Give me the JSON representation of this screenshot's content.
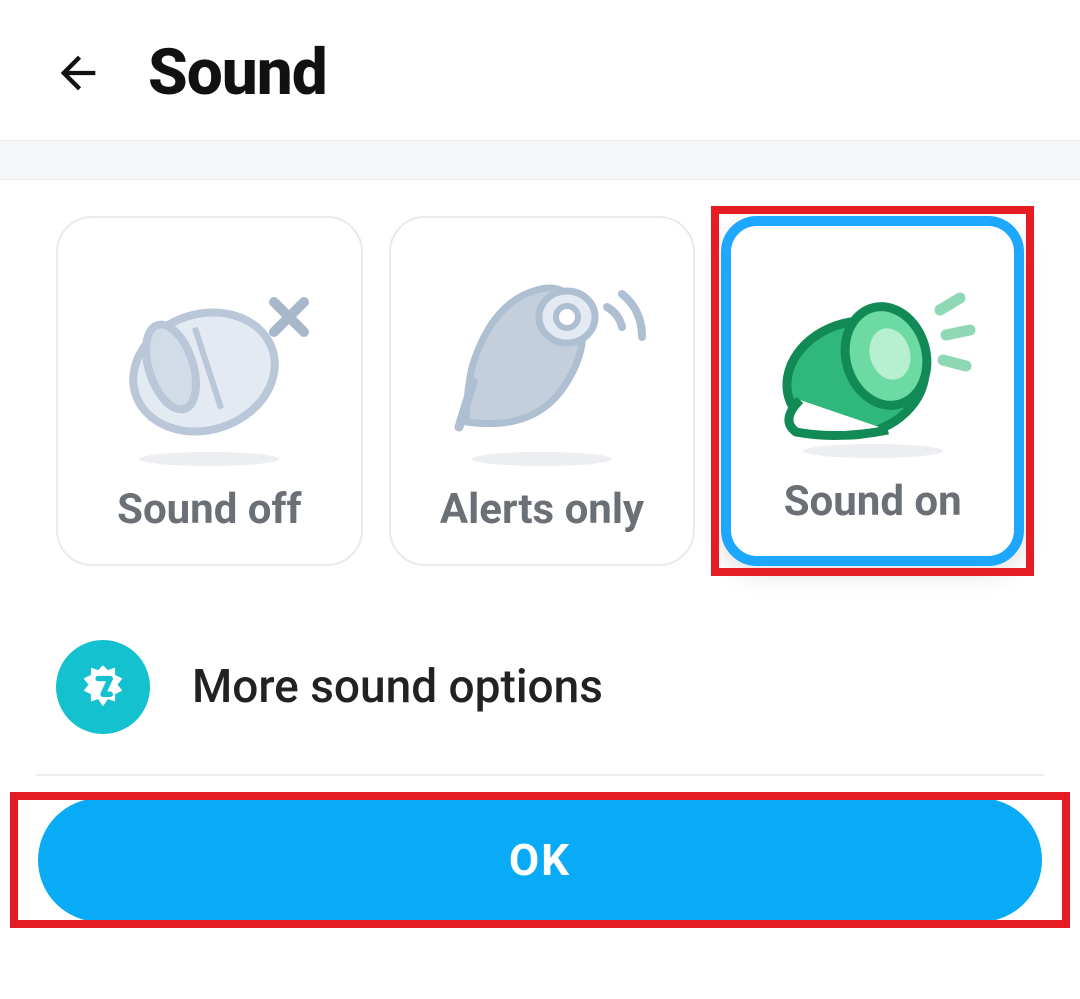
{
  "header": {
    "title": "Sound"
  },
  "options": [
    {
      "id": "sound-off",
      "label": "Sound off",
      "selected": false
    },
    {
      "id": "alerts-only",
      "label": "Alerts only",
      "selected": false
    },
    {
      "id": "sound-on",
      "label": "Sound on",
      "selected": true
    }
  ],
  "more": {
    "label": "More sound options"
  },
  "footer": {
    "ok_label": "OK"
  },
  "annotations": {
    "highlight_option_index": 2,
    "highlight_ok_button": true
  },
  "colors": {
    "accent_blue": "#09abf7",
    "selected_border": "#1ea7ff",
    "highlight_red": "#e51c23",
    "teal": "#13c1cf",
    "green": "#2fb77c"
  }
}
